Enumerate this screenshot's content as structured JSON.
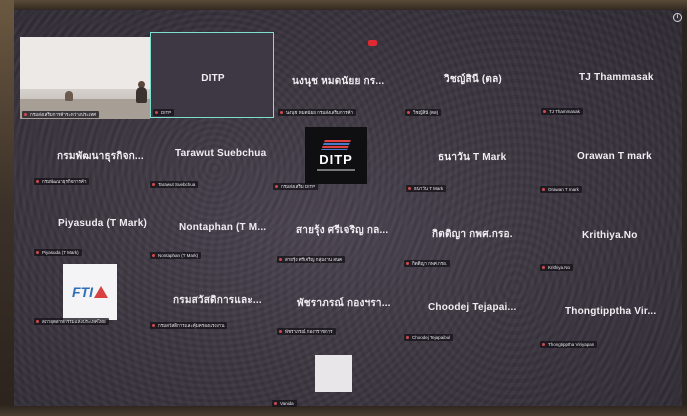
{
  "screen": {
    "info_icon": "info-icon"
  },
  "tiles": [
    {
      "id": "video",
      "tag": "กรมส่งเสริมการค้าระหว่างประเทศ"
    },
    {
      "id": "ditp",
      "name": "DITP",
      "tag": "DITP"
    },
    {
      "id": "r1c3",
      "name": "นงนุช หมดนัยย กร...",
      "tag": "นงนุช หมดนัยย กรมส่งเสริมการค้า"
    },
    {
      "id": "r1c4",
      "name": "วิชญ์สินี (ตล)",
      "tag": "วิชญ์สินี (ตล)"
    },
    {
      "id": "r1c5",
      "name": "TJ  Thammasak",
      "tag": "TJ  Thammasak"
    },
    {
      "id": "r2c1",
      "name": "กรมพัฒนาธุรกิจก...",
      "tag": "กรมพัฒนาธุรกิจการค้า"
    },
    {
      "id": "r2c2",
      "name": "Tarawut Suebchua",
      "tag": "Tarawut Suebchua"
    },
    {
      "id": "r2c3",
      "tag": "กรมส่งเสริม DITP",
      "logo": "DITP"
    },
    {
      "id": "r2c4",
      "name": "ธนาวัน T Mark",
      "tag": "ธนาวัน T Mark"
    },
    {
      "id": "r2c5",
      "name": "Orawan T mark",
      "tag": "Orawan T mark"
    },
    {
      "id": "r3c1",
      "name": "Piyasuda (T Mark)",
      "tag": "Piyasuda (T Mark)"
    },
    {
      "id": "r3c2",
      "name": "Nontaphan (T M...",
      "tag": "Nontaphan (T Mark)"
    },
    {
      "id": "r3c3",
      "name": "สายรุ้ง ศรีเจริญ กล...",
      "tag": "สายรุ้ง ศรีเจริญ กลุ่มงาน สนค"
    },
    {
      "id": "r3c4",
      "name": "กิตติญา กพศ.กรอ.",
      "tag": "กิตติญา กพศ.กรอ."
    },
    {
      "id": "r3c5",
      "name": "Krithiya.No",
      "tag": "Krithiya.No"
    },
    {
      "id": "r4c1",
      "tag": "สภาอุตสาหกรรมแห่งประเทศไทย",
      "logo": "FTI"
    },
    {
      "id": "r4c2",
      "name": "กรมสวัสดิการและ...",
      "tag": "กรมสวัสดิการและคุ้มครองแรงงาน"
    },
    {
      "id": "r4c3",
      "name": "พัชราภรณ์ กองฯรา...",
      "tag": "พัชราภรณ์ กองฯราชการ"
    },
    {
      "id": "r4c4",
      "name": "Choodej  Tejapai...",
      "tag": "Choodej Tejapaibul"
    },
    {
      "id": "r4c5",
      "name": "Thongtipptha  Vir...",
      "tag": "Thongtipptha Viriyapan"
    },
    {
      "id": "r5c3",
      "tag": "Vanida"
    }
  ]
}
